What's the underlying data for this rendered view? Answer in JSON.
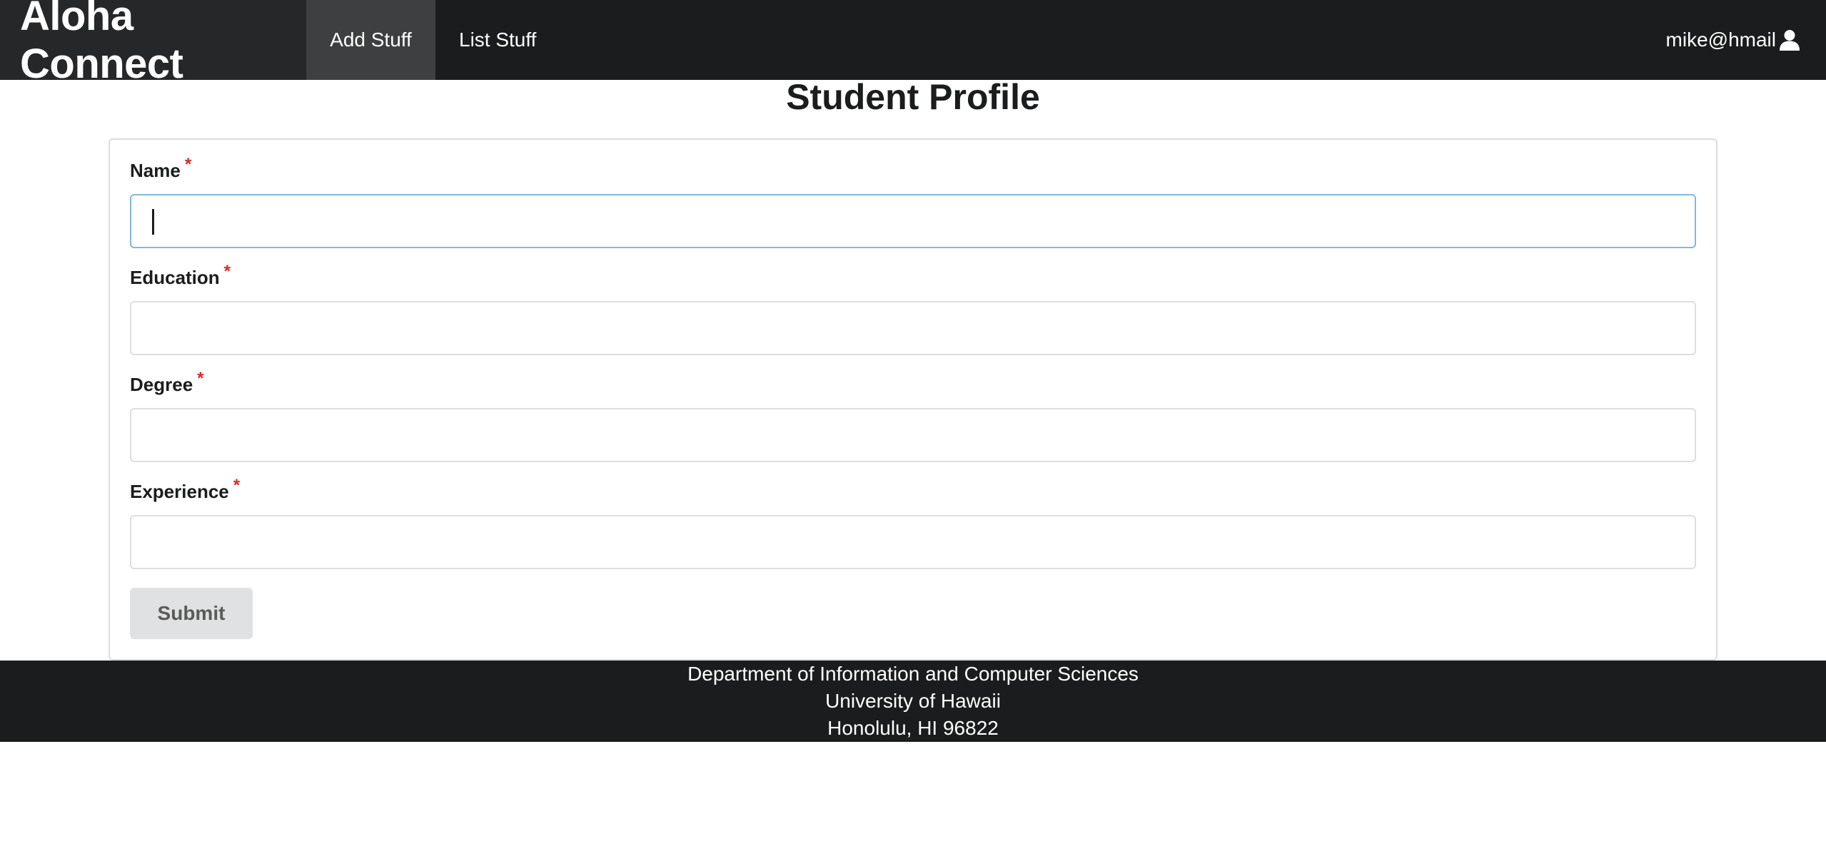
{
  "navbar": {
    "brand": "Aloha Connect",
    "items": [
      {
        "label": "Add Stuff",
        "active": true
      },
      {
        "label": "List Stuff",
        "active": false
      }
    ],
    "user": {
      "label": "mike@hmail",
      "icon": "user-icon"
    }
  },
  "page": {
    "title": "Student Profile"
  },
  "form": {
    "required_marker": "*",
    "fields": [
      {
        "label": "Name",
        "value": "",
        "focused": true
      },
      {
        "label": "Education",
        "value": ""
      },
      {
        "label": "Degree",
        "value": ""
      },
      {
        "label": "Experience",
        "value": ""
      }
    ],
    "submit_label": "Submit"
  },
  "footer": {
    "lines": [
      "Department of Information and Computer Sciences",
      "University of Hawaii",
      "Honolulu, HI 96822"
    ]
  },
  "colors": {
    "navbar_bg": "#1b1c1d",
    "active_item_bg": "#3e3f40",
    "required": "#db2828",
    "focus_border": "#85b7d9",
    "button_bg": "#e0e1e2"
  }
}
